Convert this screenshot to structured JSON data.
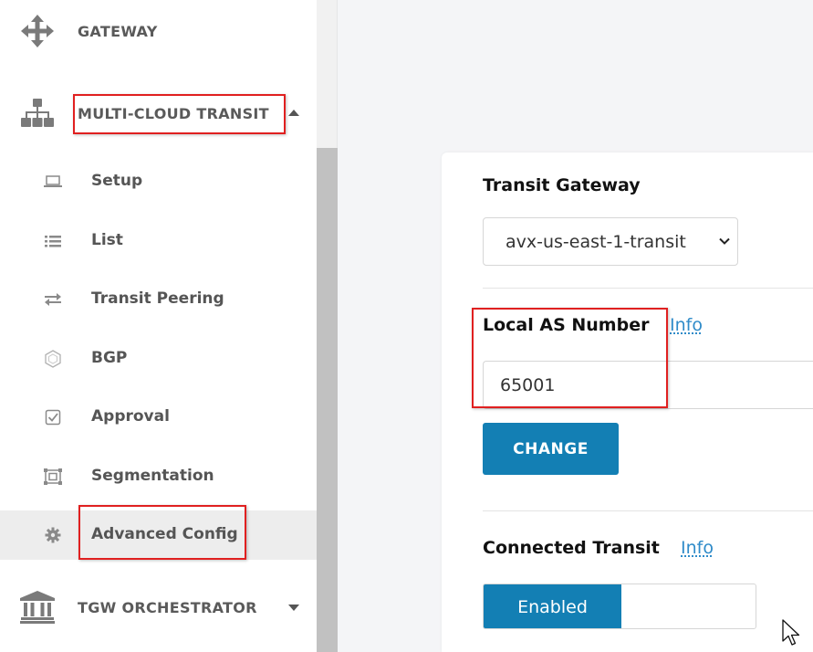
{
  "sidebar": {
    "gateway": {
      "label": "GATEWAY",
      "icon": "move-arrows-icon"
    },
    "multicloud": {
      "label": "MULTI-CLOUD TRANSIT",
      "icon": "sitemap-icon",
      "expanded": true
    },
    "items": [
      {
        "label": "Setup",
        "icon": "laptop-icon"
      },
      {
        "label": "List",
        "icon": "list-icon"
      },
      {
        "label": "Transit Peering",
        "icon": "exchange-icon"
      },
      {
        "label": "BGP",
        "icon": "hexagon-icon"
      },
      {
        "label": "Approval",
        "icon": "check-square-icon"
      },
      {
        "label": "Segmentation",
        "icon": "segment-icon"
      },
      {
        "label": "Advanced Config",
        "icon": "gear-icon",
        "active": true
      }
    ],
    "tgw": {
      "label": "TGW ORCHESTRATOR",
      "icon": "bank-icon",
      "expanded": false
    }
  },
  "form": {
    "transit_gateway": {
      "title": "Transit Gateway",
      "selected": "avx-us-east-1-transit"
    },
    "local_as": {
      "title": "Local AS Number",
      "info": "Info",
      "value": "65001",
      "button": "CHANGE"
    },
    "connected_transit": {
      "title": "Connected Transit",
      "info": "Info",
      "state": "Enabled"
    }
  },
  "colors": {
    "accent": "#137fb4",
    "highlight": "#e02020",
    "link": "#2f8bc9"
  }
}
